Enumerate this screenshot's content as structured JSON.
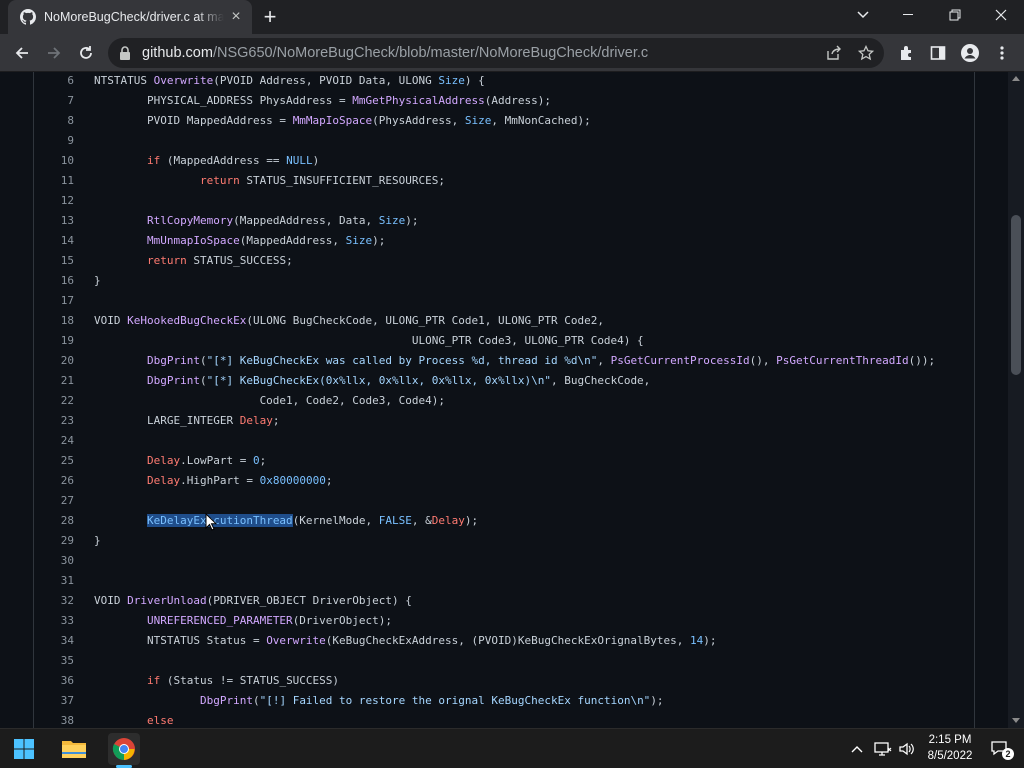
{
  "browser": {
    "tab_title": "NoMoreBugCheck/driver.c at master",
    "tab_close": "×",
    "new_tab": "+",
    "url_host": "github.com",
    "url_path": "/NSG650/NoMoreBugCheck/blob/master/NoMoreBugCheck/driver.c"
  },
  "code": {
    "lines": [
      {
        "n": "6",
        "html": "NTSTATUS <span class=\"fn\">Overwrite</span>(PVOID Address, PVOID Data, ULONG <span class=\"ct\">Size</span>) {"
      },
      {
        "n": "7",
        "html": "        PHYSICAL_ADDRESS PhysAddress = <span class=\"fn\">MmGetPhysicalAddress</span>(Address);"
      },
      {
        "n": "8",
        "html": "        PVOID MappedAddress = <span class=\"fn\">MmMapIoSpace</span>(PhysAddress, <span class=\"ct\">Size</span>, MmNonCached);"
      },
      {
        "n": "9",
        "html": ""
      },
      {
        "n": "10",
        "html": "        <span class=\"kw\">if</span> (MappedAddress == <span class=\"ct\">NULL</span>)"
      },
      {
        "n": "11",
        "html": "                <span class=\"kw\">return</span> STATUS_INSUFFICIENT_RESOURCES;"
      },
      {
        "n": "12",
        "html": ""
      },
      {
        "n": "13",
        "html": "        <span class=\"fn\">RtlCopyMemory</span>(MappedAddress, Data, <span class=\"ct\">Size</span>);"
      },
      {
        "n": "14",
        "html": "        <span class=\"fn\">MmUnmapIoSpace</span>(MappedAddress, <span class=\"ct\">Size</span>);"
      },
      {
        "n": "15",
        "html": "        <span class=\"kw\">return</span> STATUS_SUCCESS;"
      },
      {
        "n": "16",
        "html": "}"
      },
      {
        "n": "17",
        "html": ""
      },
      {
        "n": "18",
        "html": "VOID <span class=\"fn\">KeHookedBugCheckEx</span>(ULONG BugCheckCode, ULONG_PTR Code1, ULONG_PTR Code2,"
      },
      {
        "n": "19",
        "html": "                                                ULONG_PTR Code3, ULONG_PTR Code4) {"
      },
      {
        "n": "20",
        "html": "        <span class=\"fn\">DbgPrint</span>(<span class=\"st\">\"[*] KeBugCheckEx was called by Process %d, thread id %d\\n\"</span>, <span class=\"fn\">PsGetCurrentProcessId</span>(), <span class=\"fn\">PsGetCurrentThreadId</span>());"
      },
      {
        "n": "21",
        "html": "        <span class=\"fn\">DbgPrint</span>(<span class=\"st\">\"[*] KeBugCheckEx(0x%llx, 0x%llx, 0x%llx, 0x%llx)\\n\"</span>, BugCheckCode,"
      },
      {
        "n": "22",
        "html": "                         Code1, Code2, Code3, Code4);"
      },
      {
        "n": "23",
        "html": "        LARGE_INTEGER <span class=\"kw\">Delay</span>;"
      },
      {
        "n": "24",
        "html": ""
      },
      {
        "n": "25",
        "html": "        <span class=\"kw\">Delay</span>.LowPart = <span class=\"ct\">0</span>;"
      },
      {
        "n": "26",
        "html": "        <span class=\"kw\">Delay</span>.HighPart = <span class=\"ct\">0x80000000</span>;"
      },
      {
        "n": "27",
        "html": ""
      },
      {
        "n": "28",
        "html": "        <span class=\"sel\">KeDelayExecutionThread</span>(KernelMode, <span class=\"ct\">FALSE</span>, &amp;<span class=\"kw\">Delay</span>);"
      },
      {
        "n": "29",
        "html": "}"
      },
      {
        "n": "30",
        "html": ""
      },
      {
        "n": "31",
        "html": ""
      },
      {
        "n": "32",
        "html": "VOID <span class=\"fn\">DriverUnload</span>(PDRIVER_OBJECT DriverObject) {"
      },
      {
        "n": "33",
        "html": "        <span class=\"fn\">UNREFERENCED_PARAMETER</span>(DriverObject);"
      },
      {
        "n": "34",
        "html": "        NTSTATUS Status = <span class=\"fn\">Overwrite</span>(KeBugCheckExAddress, (PVOID)KeBugCheckExOrignalBytes, <span class=\"ct\">14</span>);"
      },
      {
        "n": "35",
        "html": ""
      },
      {
        "n": "36",
        "html": "        <span class=\"kw\">if</span> (Status != STATUS_SUCCESS)"
      },
      {
        "n": "37",
        "html": "                <span class=\"fn\">DbgPrint</span>(<span class=\"st\">\"[!] Failed to restore the orignal KeBugCheckEx function\\n\"</span>);"
      },
      {
        "n": "38",
        "html": "        <span class=\"kw\">else</span>"
      }
    ]
  },
  "taskbar": {
    "time": "2:15 PM",
    "date": "8/5/2022",
    "notification_count": "2"
  },
  "colors": {
    "accent": "#4cc2ff",
    "keyword": "#ff7b72",
    "function": "#d2a8ff",
    "constant": "#79c0ff",
    "string": "#a5d6ff",
    "page_bg": "#0d1117"
  }
}
